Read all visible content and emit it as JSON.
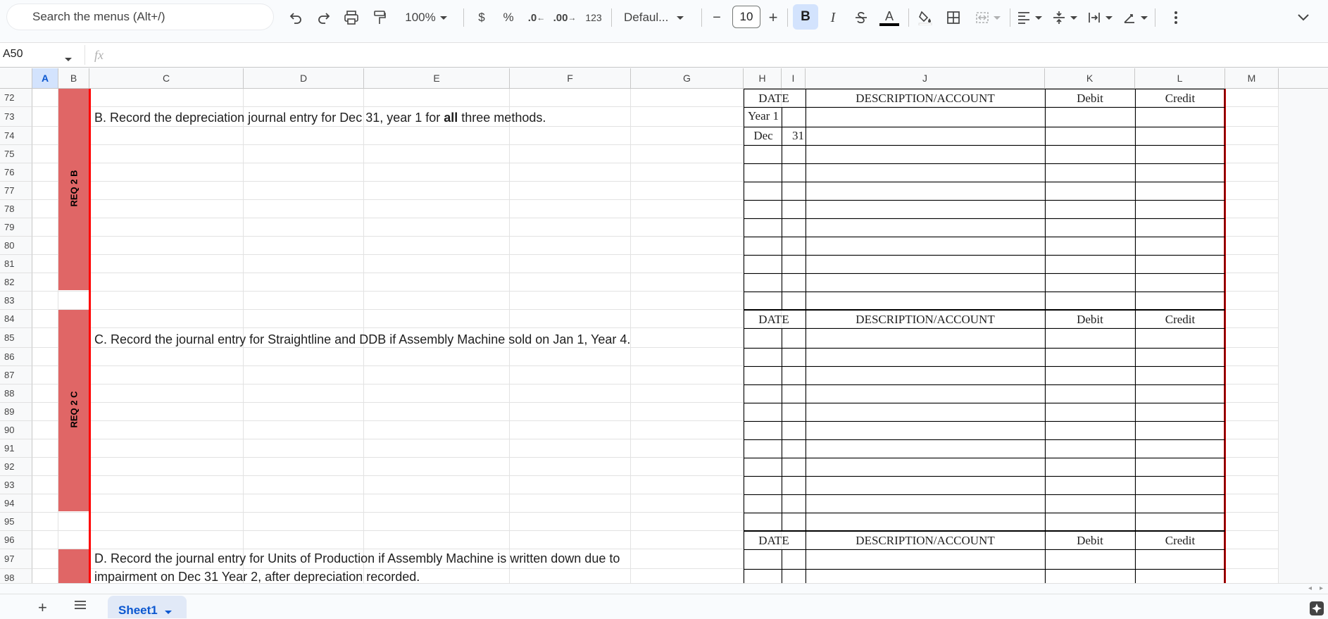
{
  "toolbar": {
    "search_placeholder": "Search the menus (Alt+/)",
    "zoom": "100%",
    "currency": "$",
    "percent": "%",
    "decrease_decimal": ".0",
    "increase_decimal": ".00",
    "number_format": "123",
    "font": "Defaul...",
    "font_size": "10",
    "minus": "−",
    "plus": "+",
    "bold": "B",
    "italic": "I",
    "text_color_letter": "A"
  },
  "formula_bar": {
    "name_box": "A50",
    "fx": "fx",
    "formula": ""
  },
  "columns": [
    "A",
    "B",
    "C",
    "D",
    "E",
    "F",
    "G",
    "H",
    "I",
    "J",
    "K",
    "L",
    "M"
  ],
  "rows": [
    "72",
    "73",
    "74",
    "75",
    "76",
    "77",
    "78",
    "79",
    "80",
    "81",
    "82",
    "83",
    "84",
    "85",
    "86",
    "87",
    "88",
    "89",
    "90",
    "91",
    "92",
    "93",
    "94",
    "95",
    "96",
    "97",
    "98"
  ],
  "sections": {
    "req2b": "REQ 2 B",
    "req2c": "REQ 2 C"
  },
  "instructions": {
    "b_pre": "B. Record the depreciation journal entry for Dec 31, year 1 for ",
    "b_bold": "all",
    "b_post": " three methods.",
    "c": "C. Record the journal entry for Straightline and DDB if Assembly Machine sold on Jan 1, Year 4.",
    "d_line1": "D. Record the journal entry for Units of Production if Assembly Machine is written down due to",
    "d_line2": "impairment on Dec 31 Year 2, after depreciation recorded."
  },
  "journal": {
    "date": "DATE",
    "description": "DESCRIPTION/ACCOUNT",
    "debit": "Debit",
    "credit": "Credit",
    "year1": "Year 1",
    "dec": "Dec",
    "day": "31"
  },
  "bottom": {
    "sheet_name": "Sheet1",
    "add": "+",
    "all_sheets": "≡"
  }
}
